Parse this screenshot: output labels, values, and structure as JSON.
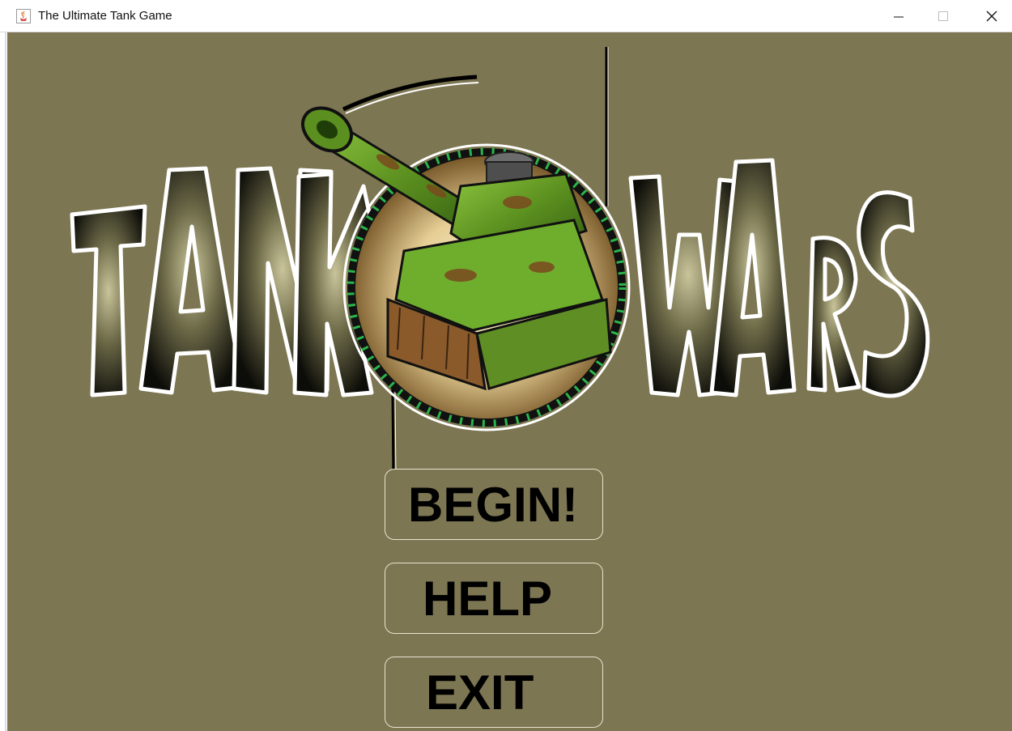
{
  "window": {
    "title": "The Ultimate Tank Game",
    "icons": {
      "app": "java-cup-icon",
      "minimize": "minimize-icon",
      "maximize": "maximize-icon",
      "close": "close-icon"
    }
  },
  "logo": {
    "word_left": "TANK",
    "word_right": "WARS"
  },
  "menu": {
    "begin_label": "BEGIN!",
    "help_label": "HELP",
    "exit_label": "EXIT"
  },
  "colors": {
    "background": "#7d7652",
    "button_border": "#e8e3cf",
    "button_text": "#000000",
    "logo_outline": "#ffffff",
    "tank_camo_green": "#5f9a1e",
    "emblem_beads": "#2bb44a"
  }
}
